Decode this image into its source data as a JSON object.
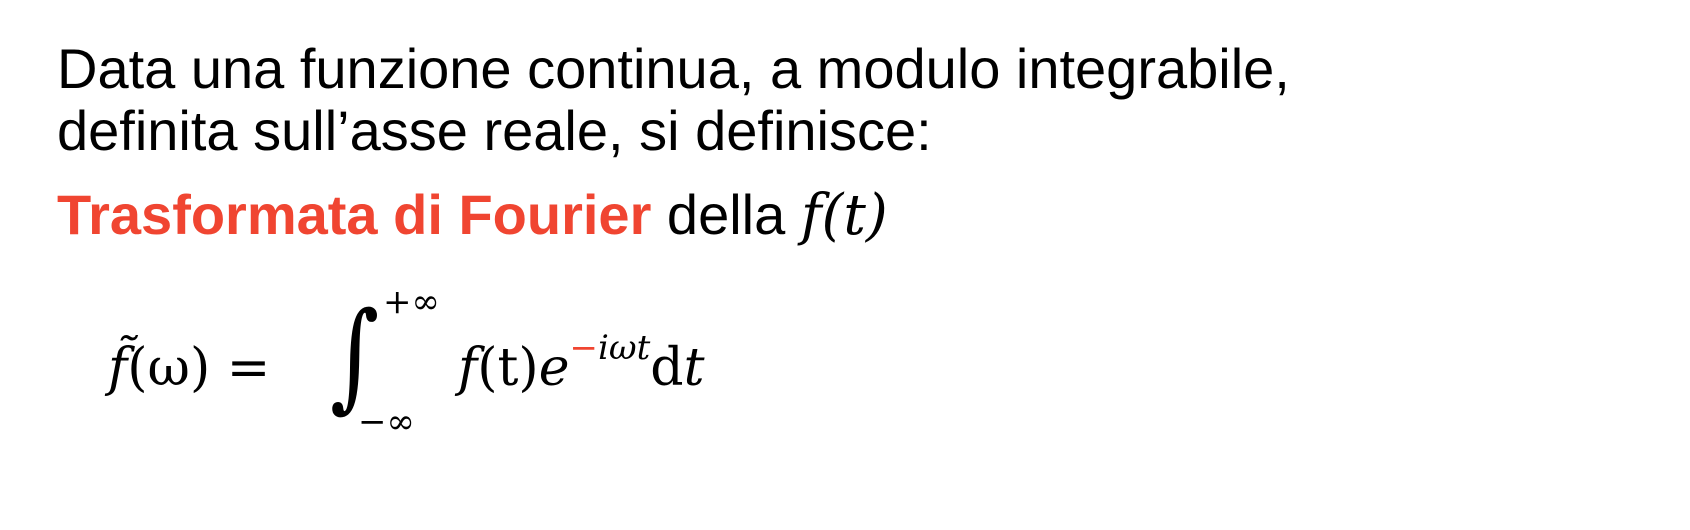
{
  "intro": {
    "line1": "Data una funzione continua, a modulo integrabile,",
    "line2": "definita sull’asse reale, si definisce:"
  },
  "heading": {
    "accent_text": "Trasformata di Fourier",
    "plain_text": " della ",
    "function_name": "f",
    "function_arg": "(t)"
  },
  "formula": {
    "lhs_function": "f̃",
    "lhs_arg": "(ω)",
    "equals": " =",
    "integral_sign": "∫",
    "upper_limit": "+∞",
    "lower_limit": "−∞",
    "integrand_function": "f",
    "integrand_arg": "(t)",
    "exponential_base": "e",
    "exponent_sign": "−",
    "exponent_body": "iωt",
    "differential_d": "d",
    "differential_var": "t"
  },
  "colors": {
    "accent": "#f04531",
    "text": "#000000",
    "background": "#ffffff"
  }
}
